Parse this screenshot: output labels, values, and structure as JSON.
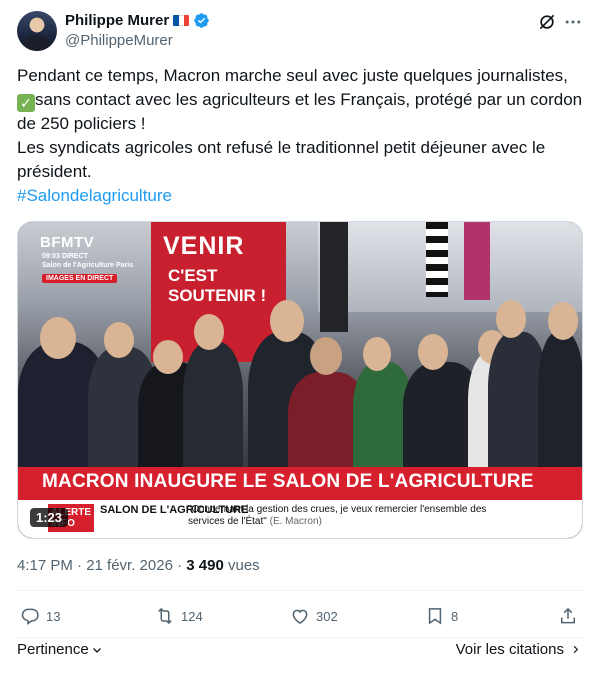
{
  "author": {
    "name": "Philippe Murer",
    "handle": "@PhilippeMurer",
    "flag_colors": [
      "#0055a4",
      "#ffffff",
      "#ef4135"
    ],
    "verified_color": "#1d9bf0"
  },
  "tweet": {
    "line1": "Pendant ce temps, Macron marche seul avec juste quelques journalistes,",
    "line2": "sans contact avec les agriculteurs et les Français, protégé par un cordon de 250 policiers !",
    "line3": "Les syndicats agricoles ont refusé le traditionnel petit déjeuner avec le président.",
    "hashtag": "#Salondelagriculture",
    "check_emoji": "✓"
  },
  "media": {
    "banner_title": "VENIR",
    "banner_sub_1": "C'EST",
    "banner_sub_2": "SOUTENIR !",
    "channel_logo": "BFMTV",
    "channel_time": "09:03",
    "channel_status": "DIRECT",
    "channel_location": "Salon de l'Agriculture Paris",
    "channel_live": "IMAGES EN DIRECT",
    "headline": "MACRON INAUGURE LE SALON DE L'AGRICULTURE",
    "alert_badge_1": "ALERTE",
    "alert_badge_2": "INFO",
    "lower_title": "SALON DE L'AGRICULTURE",
    "lower_quote": "\"Concernant la gestion des crues, je veux remercier l'ensemble des services de l'État\"",
    "lower_quote_author": "(E. Macron)",
    "duration": "1:23"
  },
  "meta": {
    "time": "4:17 PM · 21 févr. 2026 · ",
    "views": "3 490",
    "views_label": " vues"
  },
  "actions": {
    "replies": "13",
    "reposts": "124",
    "likes": "302",
    "bookmarks": "8"
  },
  "footer": {
    "sort_label": "Pertinence",
    "quotes_label": "Voir les citations"
  },
  "colors": {
    "link": "#1d9bf0",
    "secondary_text": "#536471",
    "bfm_red": "#d7202d"
  }
}
